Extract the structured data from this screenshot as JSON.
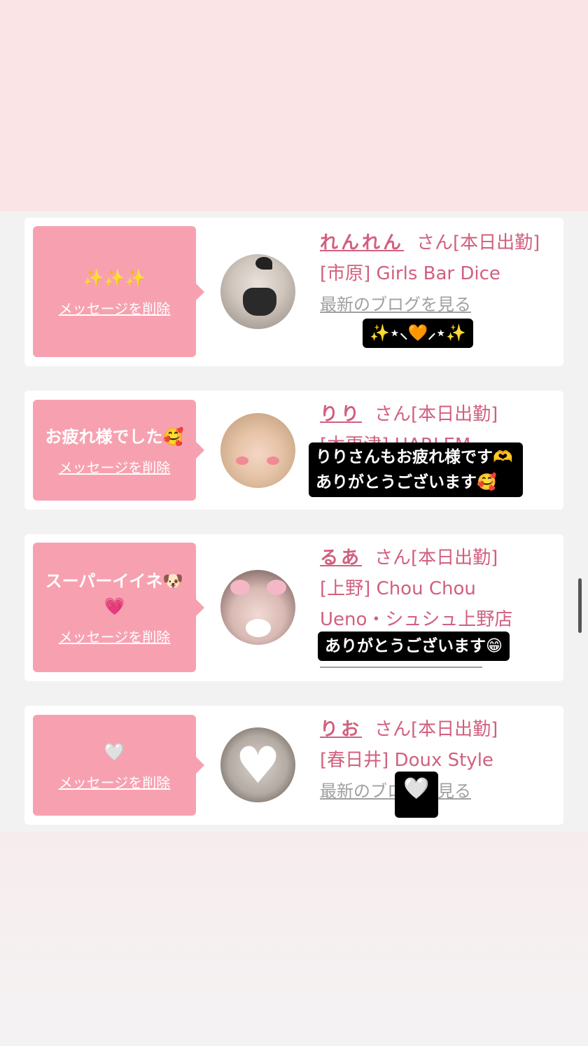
{
  "cards": [
    {
      "message": "✨✨✨",
      "delete_label": "メッセージを削除",
      "name": "れんれん",
      "suffix": "さん[本日出勤]",
      "shop": "[市原] Girls Bar Dice",
      "blog_label": "最新のブログを見る",
      "caption": "✨⋆⸜🧡⸝⋆✨"
    },
    {
      "message": "お疲れ様でした🥰",
      "delete_label": "メッセージを削除",
      "name": "りり",
      "suffix": "さん[本日出勤]",
      "shop": "[木更津] HARLEM",
      "caption_line1": "りりさんもお疲れ様です🫶",
      "caption_line2": "ありがとうございます🥰"
    },
    {
      "message_line1": "スーパーイイネ🐶",
      "message_line2": "💗",
      "delete_label": "メッセージを削除",
      "name": "るあ",
      "suffix": "さん[本日出勤]",
      "shop_line1": "[上野] Chou Chou",
      "shop_line2": "Ueno・シュシュ上野店",
      "caption": "ありがとうございます😁"
    },
    {
      "message": "🤍",
      "delete_label": "メッセージを削除",
      "name": "りお",
      "suffix": "さん[本日出勤]",
      "shop": "[春日井] Doux Style",
      "blog_label": "最新のブログを見る",
      "caption": "🤍"
    }
  ],
  "colors": {
    "accent": "#d1607e",
    "bubble": "#f7a1b0",
    "banner": "#fbe4e6",
    "background": "#f3f2f2"
  }
}
